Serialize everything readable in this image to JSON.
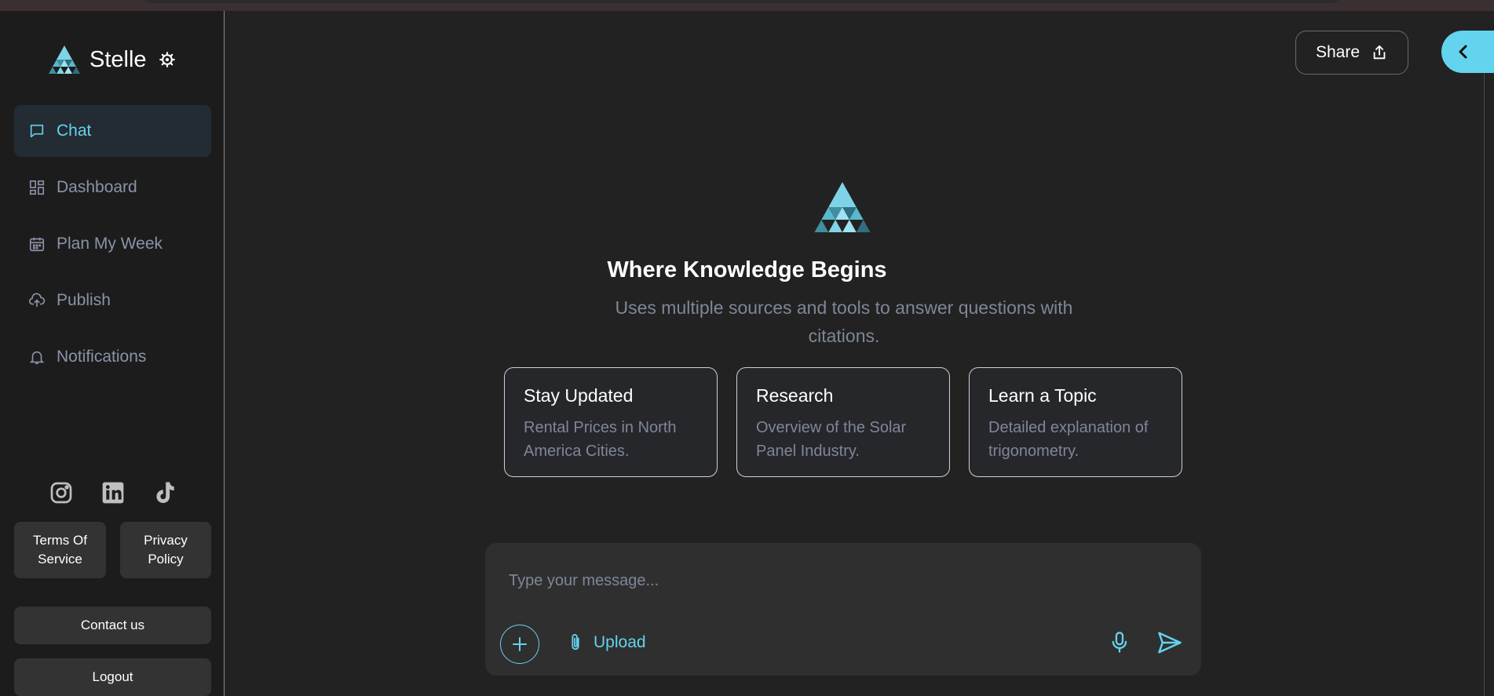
{
  "brand": {
    "name": "Stelle"
  },
  "sidebar": {
    "items": [
      {
        "label": "Chat",
        "icon": "chat-icon",
        "active": true
      },
      {
        "label": "Dashboard",
        "icon": "dashboard-icon"
      },
      {
        "label": "Plan My Week",
        "icon": "calendar-icon"
      },
      {
        "label": "Publish",
        "icon": "cloud-upload-icon"
      },
      {
        "label": "Notifications",
        "icon": "bell-icon"
      }
    ],
    "socials": [
      "instagram-icon",
      "linkedin-icon",
      "tiktok-icon"
    ],
    "terms_label": "Terms Of Service",
    "privacy_label": "Privacy Policy",
    "contact_label": "Contact us",
    "logout_label": "Logout"
  },
  "header": {
    "share_label": "Share"
  },
  "hero": {
    "title": "Where Knowledge Begins",
    "subtitle": "Uses multiple sources and tools to answer questions with citations."
  },
  "cards": [
    {
      "title": "Stay Updated",
      "description": "Rental Prices in North America Cities."
    },
    {
      "title": "Research",
      "description": "Overview of the Solar Panel Industry."
    },
    {
      "title": "Learn a Topic",
      "description": "Detailed explanation of trigonometry."
    }
  ],
  "composer": {
    "placeholder": "Type your message...",
    "upload_label": "Upload"
  },
  "colors": {
    "accent": "#64d3ee",
    "background": "#222222",
    "sidebar": "#1c1c1c"
  }
}
